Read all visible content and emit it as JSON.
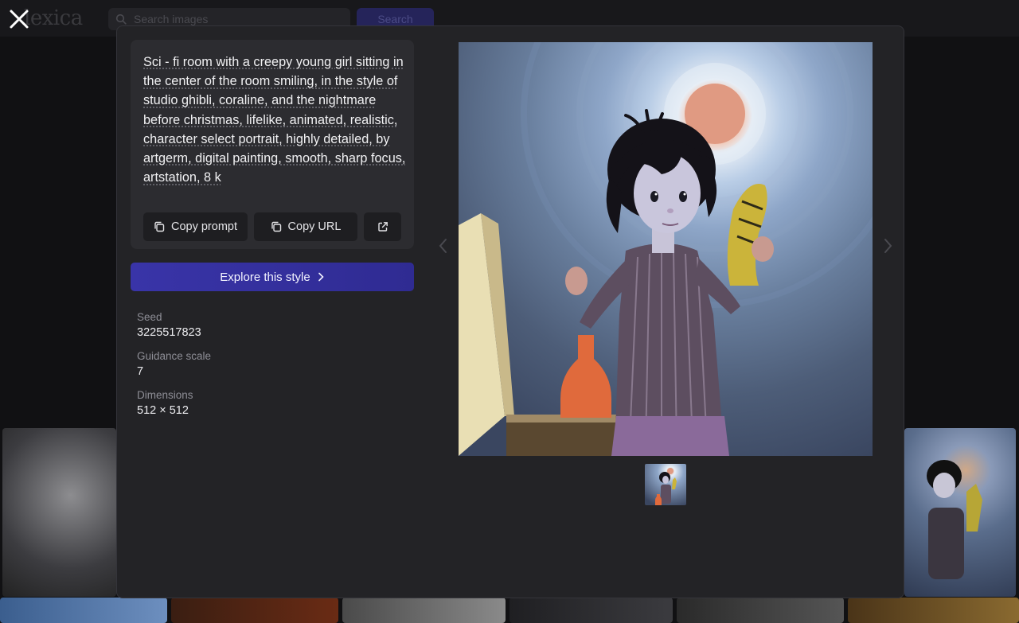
{
  "app": {
    "logo_text": "lexica",
    "search": {
      "placeholder": "Search images",
      "button_label": "Search"
    }
  },
  "modal": {
    "prompt": "Sci - fi room with a creepy young girl sitting in the center of the room smiling, in the style of studio ghibli, coraline, and the nightmare before christmas, lifelike, animated, realistic, character select portrait, highly detailed, by artgerm, digital painting, smooth, sharp focus, artstation, 8 k",
    "buttons": {
      "copy_prompt": "Copy prompt",
      "copy_url": "Copy URL",
      "open_icon": "external-link-icon"
    },
    "explore_label": "Explore this style",
    "meta": {
      "seed_label": "Seed",
      "seed_value": "3225517823",
      "guidance_label": "Guidance scale",
      "guidance_value": "7",
      "dimensions_label": "Dimensions",
      "dimensions_value": "512 × 512"
    }
  },
  "colors": {
    "background": "#111113",
    "modal": "#232326",
    "card": "#2c2c30",
    "accent": "#3934a8"
  }
}
